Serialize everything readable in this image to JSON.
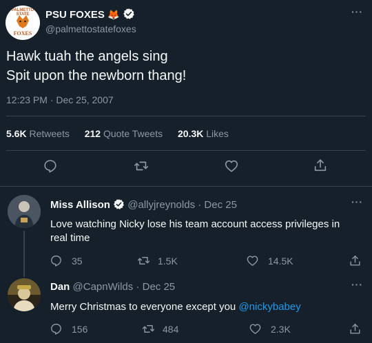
{
  "main_tweet": {
    "display_name": "PSU FOXES",
    "name_emoji": "🦊",
    "handle": "@palmettostatefoxes",
    "avatar_text_top": "PALMETTO STATE",
    "avatar_text_bottom": "FOXES",
    "text_line1": "Hawk tuah the angels sing",
    "text_line2": "Spit upon the newborn thang!",
    "timestamp": "12:23 PM · Dec 25, 2007",
    "retweets_count": "5.6K",
    "retweets_label": "Retweets",
    "quotes_count": "212",
    "quotes_label": "Quote Tweets",
    "likes_count": "20.3K",
    "likes_label": "Likes"
  },
  "replies": [
    {
      "display_name": "Miss Allison",
      "handle": "@allyjreynolds",
      "separator": "·",
      "date": "Dec 25",
      "text_line1": "Love watching Nicky lose his team account access privileges in",
      "text_line2": "real time",
      "reply_count": "35",
      "retweet_count": "1.5K",
      "like_count": "14.5K"
    },
    {
      "display_name": "Dan",
      "handle": "@CapnWilds",
      "separator": "·",
      "date": "Dec 25",
      "text": "Merry Christmas to everyone except you ",
      "mention": "@nickybabey",
      "reply_count": "156",
      "retweet_count": "484",
      "like_count": "2.3K"
    }
  ],
  "colors": {
    "background": "#15202b",
    "text": "#f7f9f9",
    "muted": "#8b98a5",
    "link": "#1d9bf0",
    "divider": "#38444d"
  }
}
